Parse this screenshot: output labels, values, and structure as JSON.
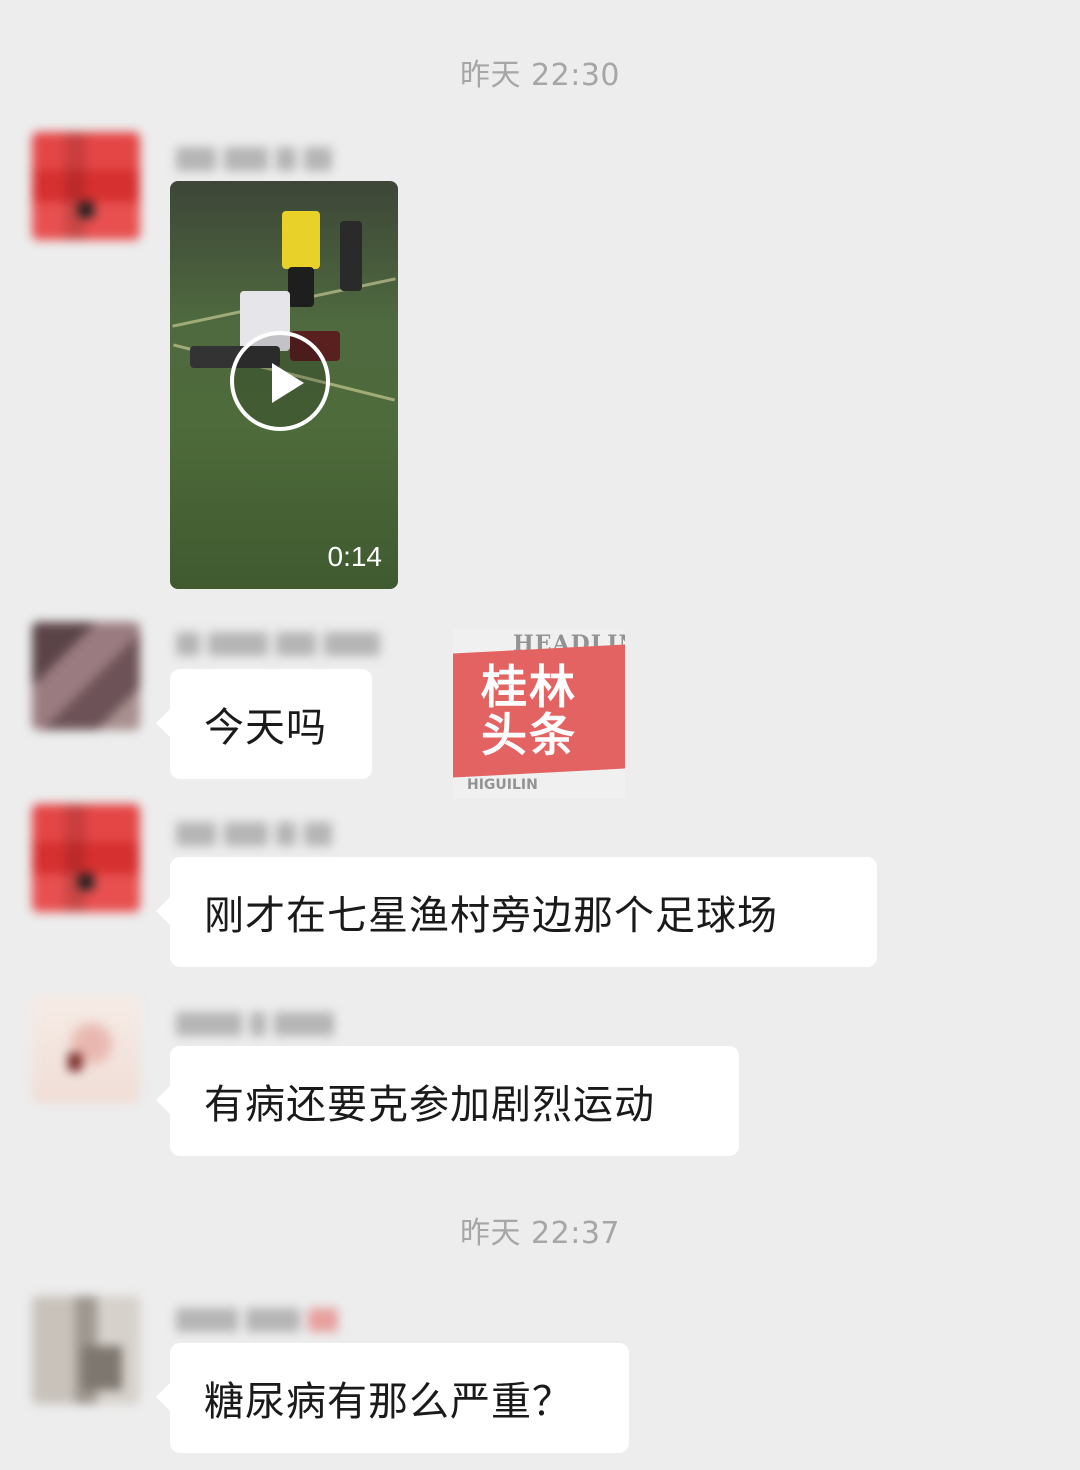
{
  "timestamps": [
    "昨天 22:30",
    "昨天 22:37"
  ],
  "video": {
    "duration": "0:14",
    "play_icon": "play-icon"
  },
  "watermark": {
    "top": "HEADLIN",
    "text": "桂林\n头条",
    "bottom": "HIGUILIN"
  },
  "messages": [
    {
      "text": "今天吗"
    },
    {
      "text": "刚才在七星渔村旁边那个足球场"
    },
    {
      "text": "有病还要克参加剧烈运动"
    },
    {
      "text": "糖尿病有那么严重？"
    }
  ]
}
